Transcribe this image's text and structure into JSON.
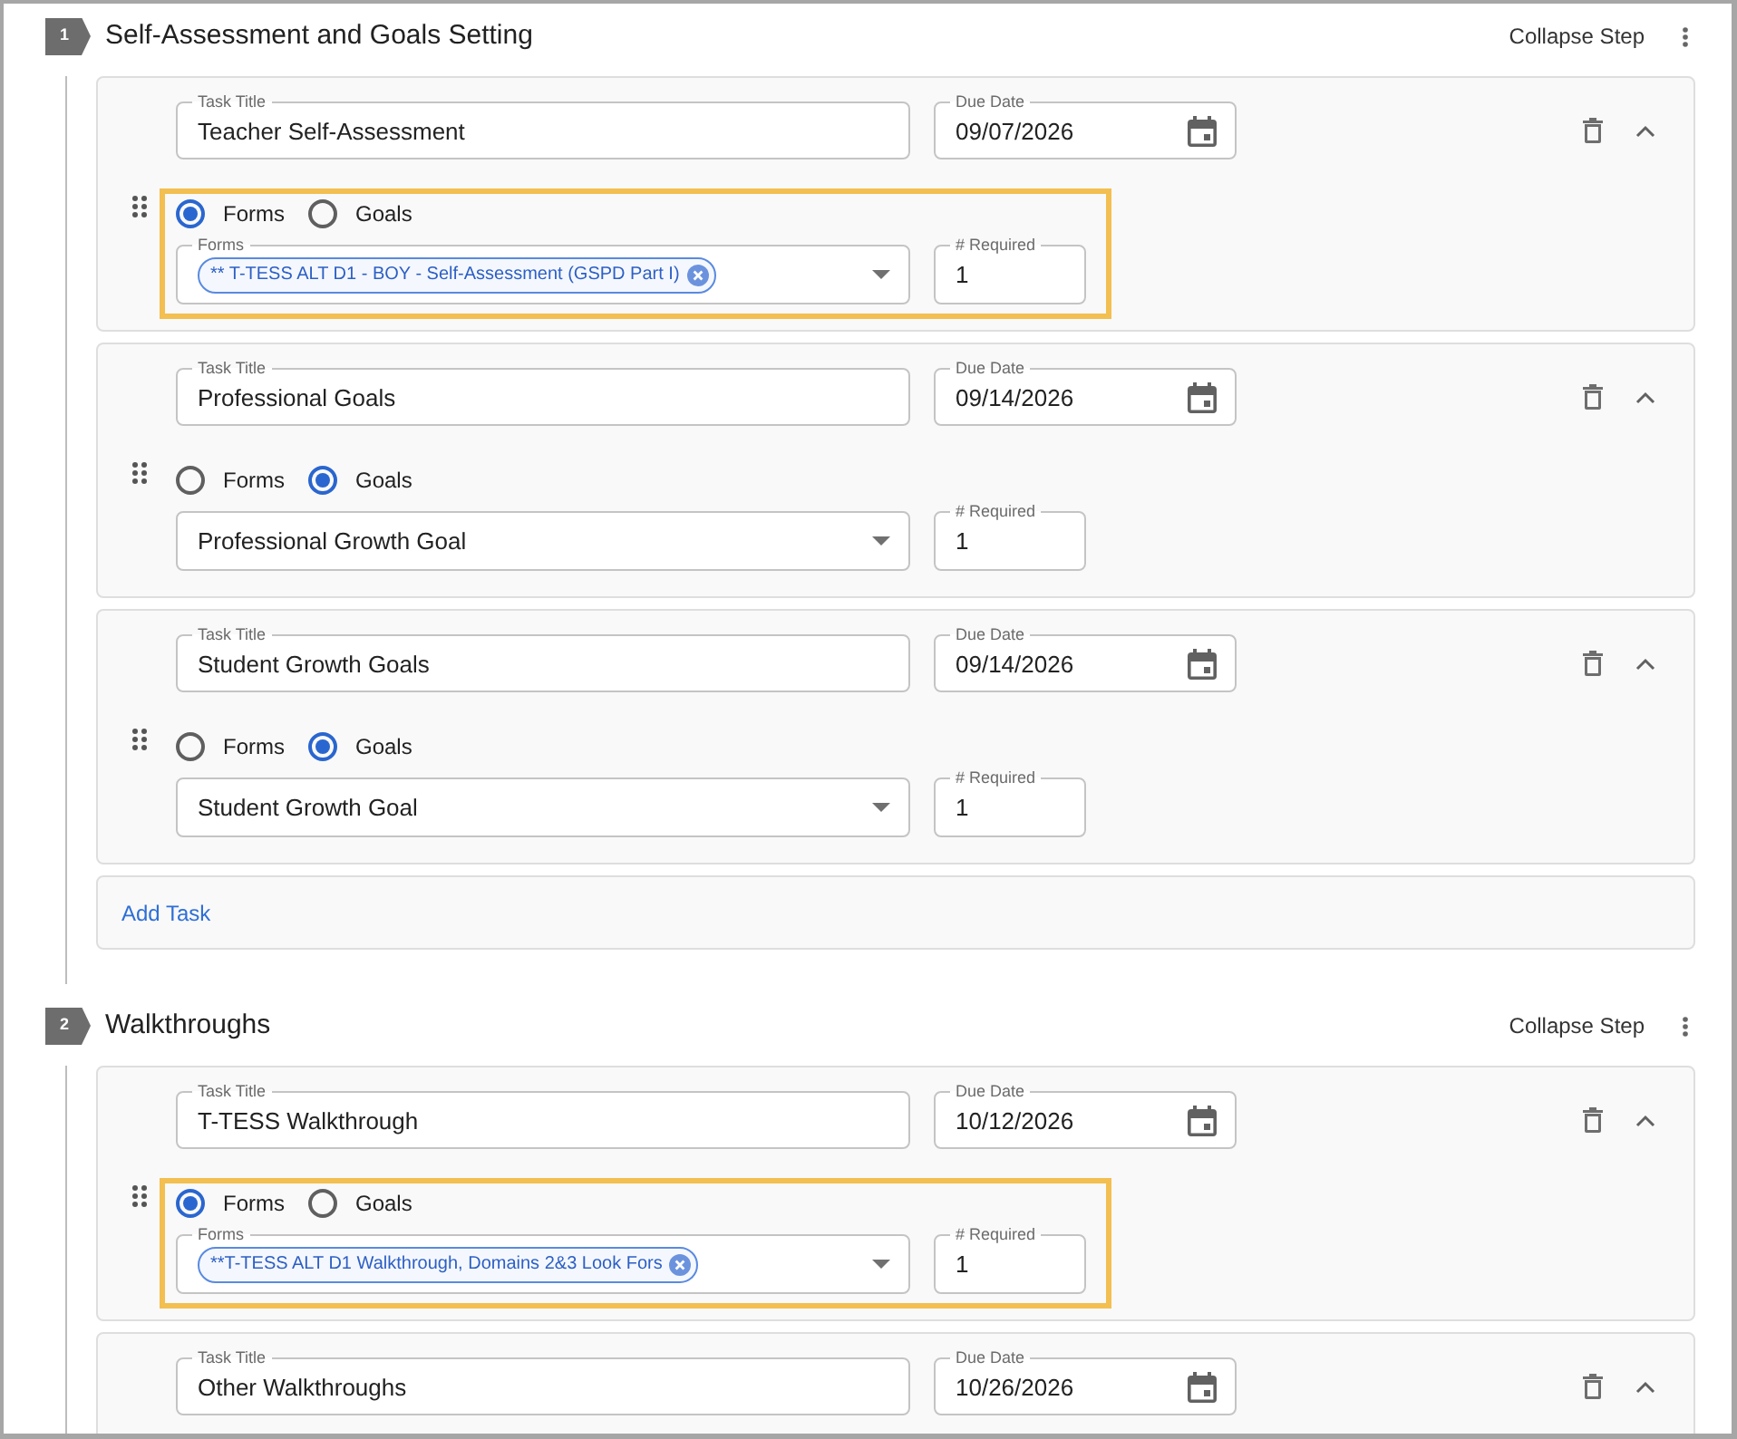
{
  "steps": [
    {
      "number": "1",
      "title": "Self-Assessment and Goals Setting",
      "collapse_label": "Collapse Step",
      "tasks": [
        {
          "expanded": true,
          "highlighted": true,
          "title_field": {
            "label": "Task Title",
            "value": "Teacher Self-Assessment"
          },
          "due_date_field": {
            "label": "Due Date",
            "value": "09/07/2026"
          },
          "type_options": [
            {
              "label": "Forms",
              "selected": true
            },
            {
              "label": "Goals",
              "selected": false
            }
          ],
          "item_field": {
            "kind": "chips",
            "label": "Forms",
            "chips": [
              "** T-TESS ALT D1 - BOY - Self-Assessment (GSPD Part I)"
            ]
          },
          "required_field": {
            "label": "# Required",
            "value": "1"
          }
        },
        {
          "expanded": true,
          "highlighted": false,
          "title_field": {
            "label": "Task Title",
            "value": "Professional Goals"
          },
          "due_date_field": {
            "label": "Due Date",
            "value": "09/14/2026"
          },
          "type_options": [
            {
              "label": "Forms",
              "selected": false
            },
            {
              "label": "Goals",
              "selected": true
            }
          ],
          "item_field": {
            "kind": "select",
            "value": "Professional Growth Goal"
          },
          "required_field": {
            "label": "# Required",
            "value": "1"
          }
        },
        {
          "expanded": true,
          "highlighted": false,
          "title_field": {
            "label": "Task Title",
            "value": "Student Growth Goals"
          },
          "due_date_field": {
            "label": "Due Date",
            "value": "09/14/2026"
          },
          "type_options": [
            {
              "label": "Forms",
              "selected": false
            },
            {
              "label": "Goals",
              "selected": true
            }
          ],
          "item_field": {
            "kind": "select",
            "value": "Student Growth Goal"
          },
          "required_field": {
            "label": "# Required",
            "value": "1"
          }
        }
      ],
      "add_task_label": "Add Task"
    },
    {
      "number": "2",
      "title": "Walkthroughs",
      "collapse_label": "Collapse Step",
      "tasks": [
        {
          "expanded": true,
          "highlighted": true,
          "title_field": {
            "label": "Task Title",
            "value": "T-TESS Walkthrough"
          },
          "due_date_field": {
            "label": "Due Date",
            "value": "10/12/2026"
          },
          "type_options": [
            {
              "label": "Forms",
              "selected": true
            },
            {
              "label": "Goals",
              "selected": false
            }
          ],
          "item_field": {
            "kind": "chips",
            "label": "Forms",
            "chips": [
              "**T-TESS ALT D1 Walkthrough, Domains 2&3 Look Fors"
            ]
          },
          "required_field": {
            "label": "# Required",
            "value": "1"
          }
        },
        {
          "expanded": true,
          "title_field": {
            "label": "Task Title",
            "value": "Other Walkthroughs"
          },
          "due_date_field": {
            "label": "Due Date",
            "value": "10/26/2026"
          }
        }
      ]
    }
  ]
}
